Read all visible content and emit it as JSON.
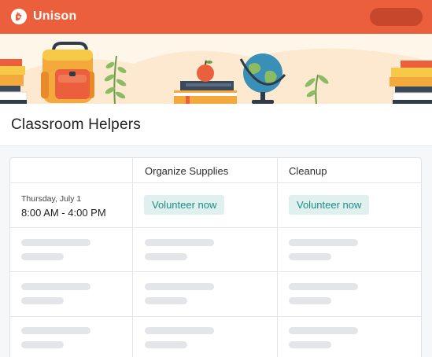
{
  "app": {
    "brand_name": "Unison",
    "logo_icon": "hand-heart-icon",
    "brand_color": "#eb5f3c"
  },
  "banner": {
    "illustration": "school-supplies-illustration"
  },
  "page": {
    "title": "Classroom Helpers"
  },
  "table": {
    "columns": [
      "",
      "Organize Supplies",
      "Cleanup"
    ],
    "rows": [
      {
        "day": "Thursday, July 1",
        "time": "8:00 AM - 4:00 PM",
        "actions": [
          "Volunteer now",
          "Volunteer now"
        ]
      }
    ],
    "placeholder_rows": 3,
    "accent_color": "#1f8c85"
  }
}
